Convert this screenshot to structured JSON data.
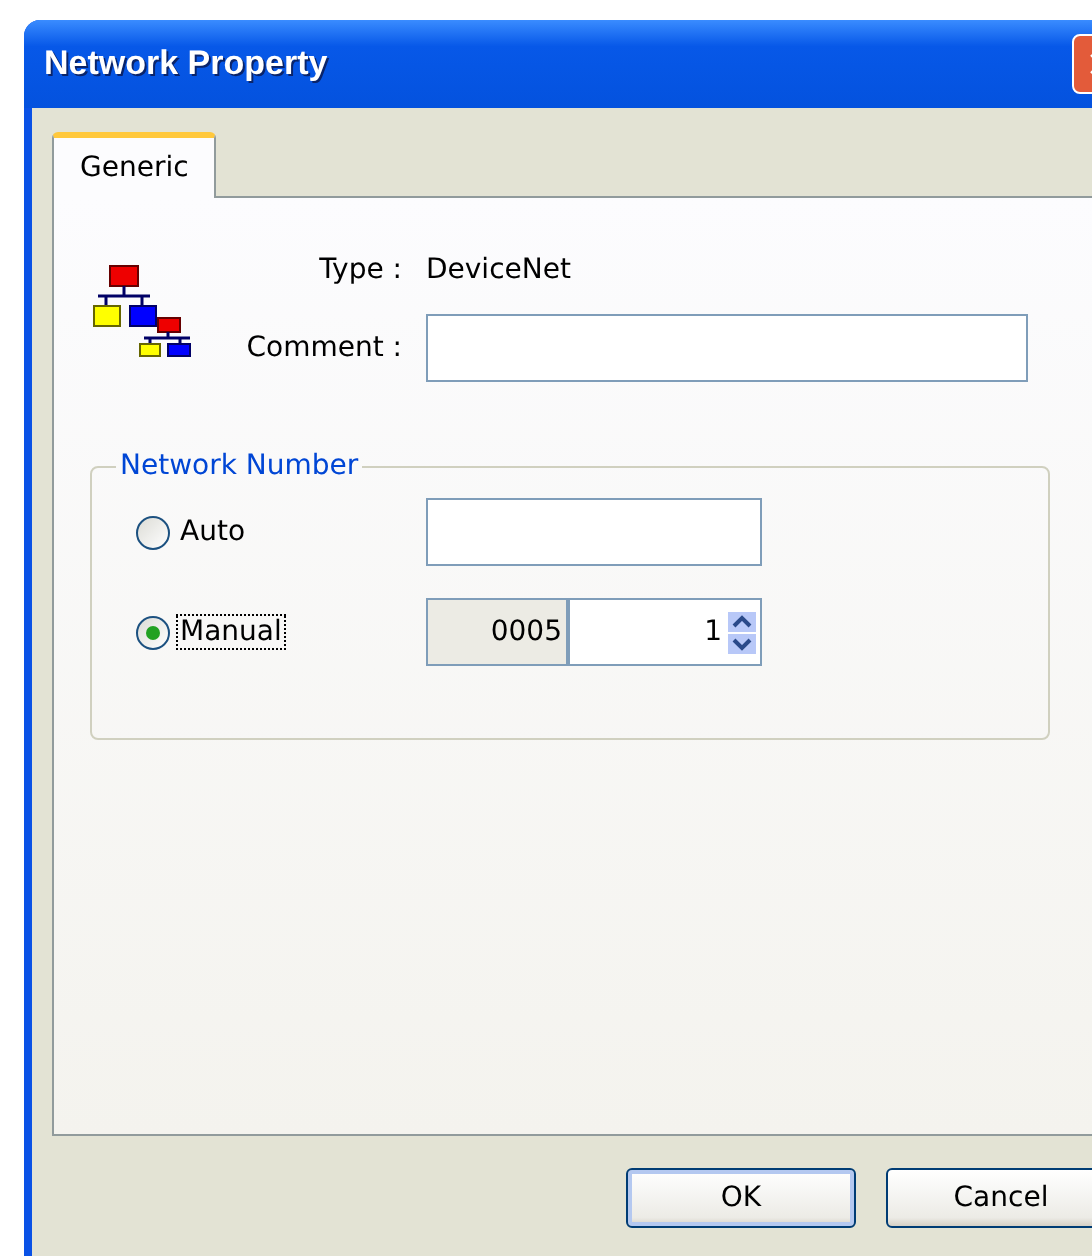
{
  "window": {
    "title": "Network Property"
  },
  "tabs": [
    {
      "label": "Generic",
      "selected": true
    }
  ],
  "type": {
    "label": "Type :",
    "value": "DeviceNet"
  },
  "comment": {
    "label": "Comment :"
  },
  "network_number": {
    "title": "Network Number",
    "options": [
      {
        "label": "Auto",
        "selected": false
      },
      {
        "label": "Manual",
        "selected": true
      }
    ],
    "prefix": "0005",
    "value": "1"
  },
  "buttons": [
    {
      "label": "OK",
      "default": true
    },
    {
      "label": "Cancel",
      "default": false
    }
  ]
}
